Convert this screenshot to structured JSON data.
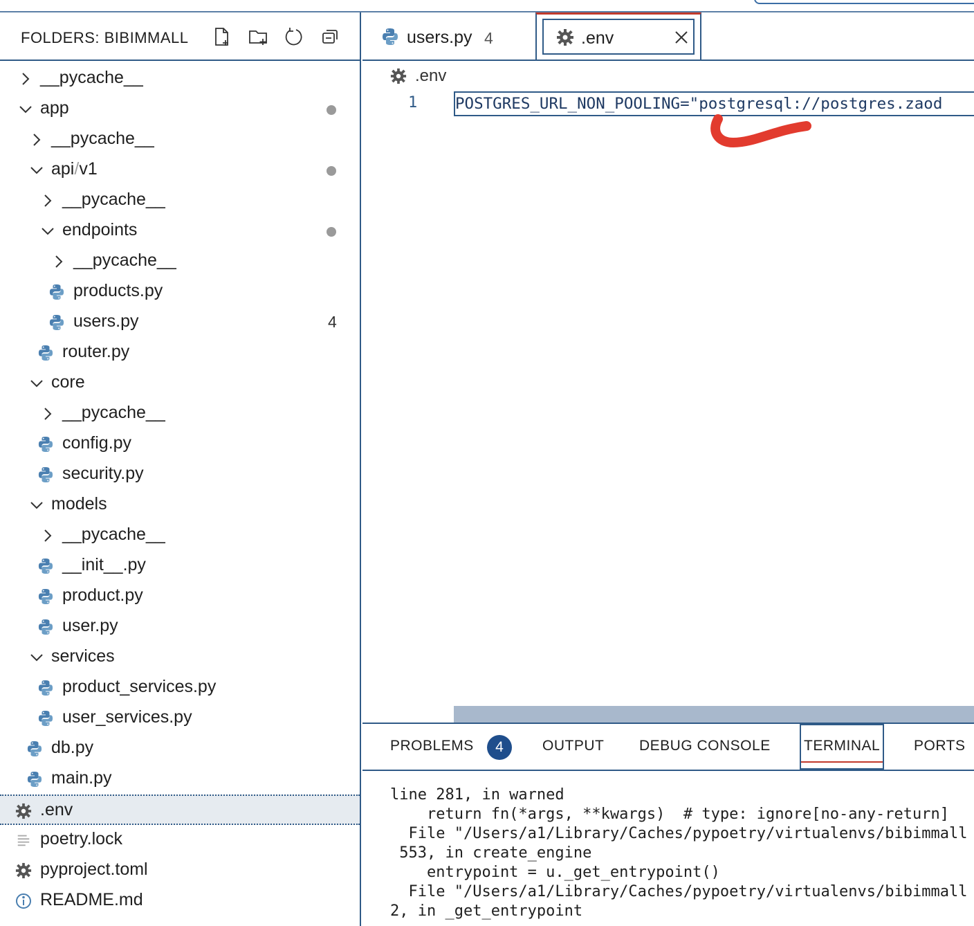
{
  "sidebar": {
    "title": "FOLDERS: BIBIMMALL",
    "tree": [
      {
        "label": "__pycache__",
        "kind": "folder-closed"
      },
      {
        "label": "app",
        "kind": "folder-open",
        "dot": true
      },
      {
        "label": "__pycache__",
        "kind": "folder-closed"
      },
      {
        "label_a": "api",
        "label_sep": "/",
        "label_b": "v1",
        "kind": "folder-open",
        "dot": true
      },
      {
        "label": "__pycache__",
        "kind": "folder-closed"
      },
      {
        "label": "endpoints",
        "kind": "folder-open",
        "dot": true
      },
      {
        "label": "__pycache__",
        "kind": "folder-closed"
      },
      {
        "label": "products.py",
        "kind": "python"
      },
      {
        "label": "users.py",
        "kind": "python",
        "count": "4"
      },
      {
        "label": "router.py",
        "kind": "python"
      },
      {
        "label": "core",
        "kind": "folder-open"
      },
      {
        "label": "__pycache__",
        "kind": "folder-closed"
      },
      {
        "label": "config.py",
        "kind": "python"
      },
      {
        "label": "security.py",
        "kind": "python"
      },
      {
        "label": "models",
        "kind": "folder-open"
      },
      {
        "label": "__pycache__",
        "kind": "folder-closed"
      },
      {
        "label": "__init__.py",
        "kind": "python"
      },
      {
        "label": "product.py",
        "kind": "python"
      },
      {
        "label": "user.py",
        "kind": "python"
      },
      {
        "label": "services",
        "kind": "folder-open"
      },
      {
        "label": "product_services.py",
        "kind": "python"
      },
      {
        "label": "user_services.py",
        "kind": "python"
      },
      {
        "label": "db.py",
        "kind": "python"
      },
      {
        "label": "main.py",
        "kind": "python"
      },
      {
        "label": ".env",
        "kind": "gear",
        "selected": true
      },
      {
        "label": "poetry.lock",
        "kind": "lines"
      },
      {
        "label": "pyproject.toml",
        "kind": "gear"
      },
      {
        "label": "README.md",
        "kind": "info"
      }
    ]
  },
  "tabs": [
    {
      "label": "users.py",
      "count": "4",
      "icon": "python-icon"
    },
    {
      "label": ".env",
      "icon": "gear-icon",
      "active": true
    }
  ],
  "breadcrumb": {
    "label": ".env"
  },
  "editor": {
    "line_number": "1",
    "code": "POSTGRES_URL_NON_POOLING=\"postgresql://postgres.zaod"
  },
  "panel": {
    "tabs": [
      "PROBLEMS",
      "OUTPUT",
      "DEBUG CONSOLE",
      "TERMINAL",
      "PORTS"
    ],
    "problems_count": "4",
    "active_tab": "TERMINAL",
    "terminal_lines": [
      "line 281, in warned",
      "    return fn(*args, **kwargs)  # type: ignore[no-any-return]",
      "  File \"/Users/a1/Library/Caches/pypoetry/virtualenvs/bibimmall",
      " 553, in create_engine",
      "    entrypoint = u._get_entrypoint()",
      "  File \"/Users/a1/Library/Caches/pypoetry/virtualenvs/bibimmall",
      "2, in _get_entrypoint"
    ]
  },
  "colors": {
    "accent": "#2f5a87",
    "badge": "#1f4e8c",
    "python_icon": "#4a7fb0",
    "annotation": "#e23b2e",
    "active_tab_top": "#c0392b"
  }
}
